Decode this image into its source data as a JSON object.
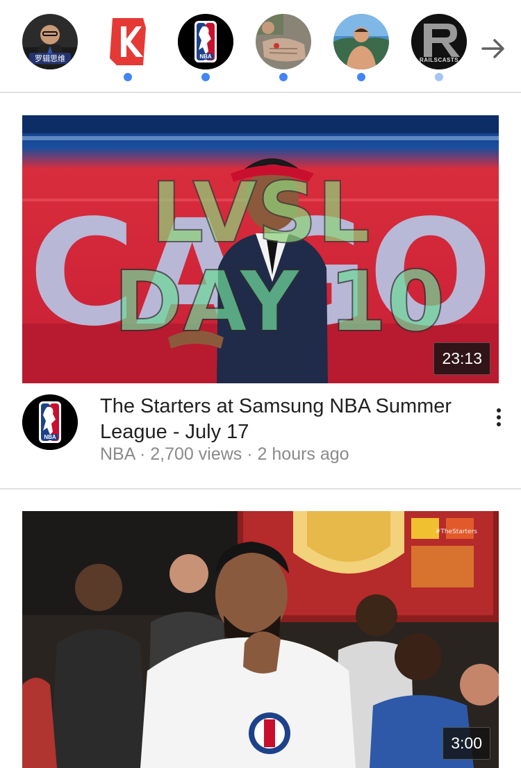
{
  "subscriptions": [
    {
      "name": "luo-channel",
      "logo_text": "罗辑思维",
      "has_new": false
    },
    {
      "name": "k-channel",
      "logo_text": "K",
      "has_new": true
    },
    {
      "name": "nba-channel",
      "logo_text": "NBA",
      "has_new": true
    },
    {
      "name": "hands-channel",
      "logo_text": "",
      "has_new": true
    },
    {
      "name": "fitness-channel",
      "logo_text": "",
      "has_new": true
    },
    {
      "name": "railscasts-channel",
      "logo_text": "RAILSCASTS",
      "has_new": true
    }
  ],
  "next_icon": "arrow-right-icon",
  "accent_color": "#4285f4",
  "videos": [
    {
      "thumbnail_overlay_top": "LVSL",
      "thumbnail_overlay_bottom": "DAY 10",
      "thumbnail_bg_text": "CAGO",
      "duration": "23:13",
      "title": "The Starters at Samsung NBA Summer League - July 17",
      "channel": "NBA",
      "views": "2,700 views",
      "age": "2 hours ago",
      "channel_logo_text": "NBA"
    },
    {
      "thumbnail_watermark": "#TheStarters",
      "duration": "3:00"
    }
  ]
}
